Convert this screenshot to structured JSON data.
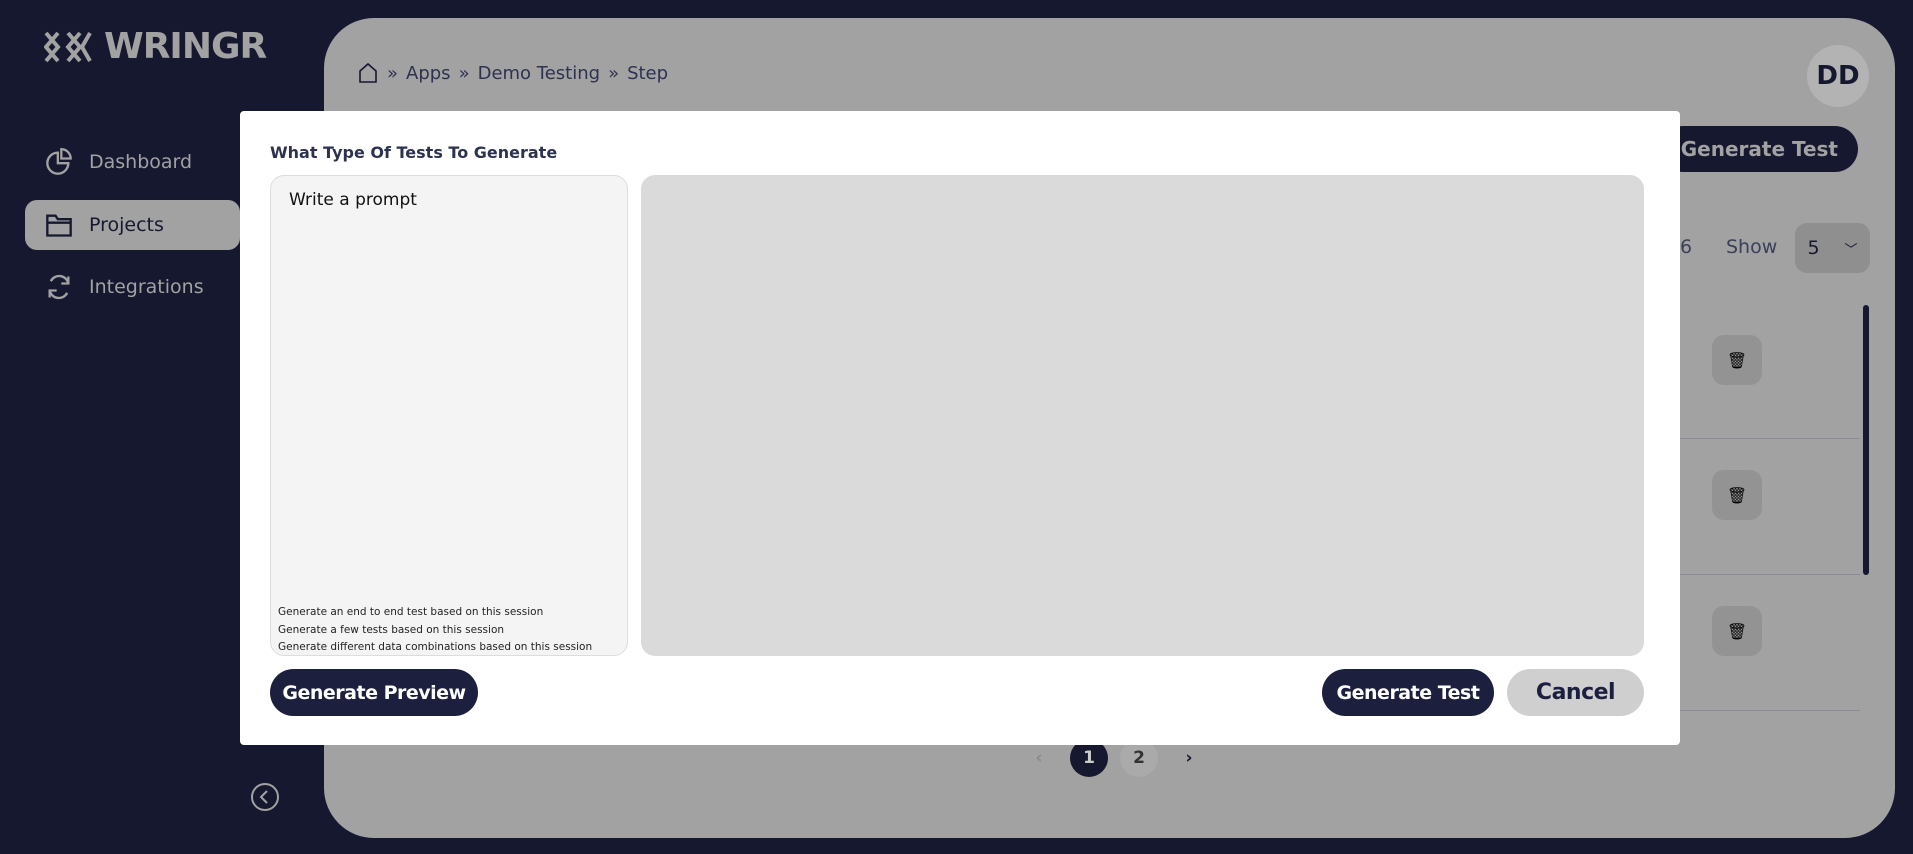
{
  "brand": {
    "name": "WRINGR"
  },
  "sidebar": {
    "items": [
      {
        "label": "Dashboard",
        "icon": "pie-chart-icon"
      },
      {
        "label": "Projects",
        "icon": "folder-icon",
        "active": true
      },
      {
        "label": "Integrations",
        "icon": "refresh-icon"
      }
    ]
  },
  "breadcrumb": [
    "Apps",
    "Demo Testing",
    "Step"
  ],
  "header": {
    "avatar": "DD",
    "generate_test": "Generate Test"
  },
  "table_controls": {
    "count": "6",
    "show_label": "Show",
    "page_size": "5"
  },
  "pagination": {
    "pages": [
      "1",
      "2"
    ],
    "current": "1"
  },
  "modal": {
    "title": "What Type Of Tests To Generate",
    "prompt_placeholder": "Write a prompt",
    "prompt_value": "",
    "suggestions": [
      "Generate an end to end test based on this session",
      "Generate a few tests based on this session",
      "Generate different data combinations based on this session"
    ],
    "generate_preview": "Generate Preview",
    "generate_test": "Generate Test",
    "cancel": "Cancel"
  },
  "colors": {
    "sidebar": "#161830",
    "accent": "#1c1f3e",
    "overlay_panel": "#a2a2a2"
  }
}
